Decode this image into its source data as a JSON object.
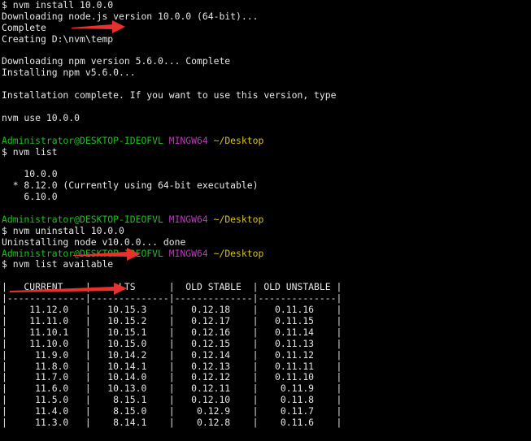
{
  "colors": {
    "background": "#000000",
    "text": "#e6e6e6",
    "prompt_user": "#1fc01f",
    "prompt_system": "#c037c0",
    "prompt_path": "#d8c31c",
    "annotation_arrow": "#e8302c"
  },
  "prompt": {
    "user_host": "Administrator@DESKTOP-IDEOFVL",
    "system": "MINGW64",
    "path": "~/Desktop"
  },
  "lines": [
    {
      "type": "text",
      "text": "$ nvm install 10.0.0"
    },
    {
      "type": "text",
      "text": "Downloading node.js version 10.0.0 (64-bit)..."
    },
    {
      "type": "text",
      "text": "Complete"
    },
    {
      "type": "text",
      "text": "Creating D:\\nvm\\temp"
    },
    {
      "type": "text",
      "text": ""
    },
    {
      "type": "text",
      "text": "Downloading npm version 5.6.0... Complete"
    },
    {
      "type": "text",
      "text": "Installing npm v5.6.0..."
    },
    {
      "type": "text",
      "text": ""
    },
    {
      "type": "text",
      "text": "Installation complete. If you want to use this version, type"
    },
    {
      "type": "text",
      "text": ""
    },
    {
      "type": "text",
      "text": "nvm use 10.0.0"
    },
    {
      "type": "text",
      "text": ""
    },
    {
      "type": "prompt"
    },
    {
      "type": "text",
      "text": "$ nvm list"
    },
    {
      "type": "text",
      "text": ""
    },
    {
      "type": "text",
      "text": "    10.0.0"
    },
    {
      "type": "text",
      "text": "  * 8.12.0 (Currently using 64-bit executable)"
    },
    {
      "type": "text",
      "text": "    6.10.0"
    },
    {
      "type": "text",
      "text": ""
    },
    {
      "type": "prompt"
    },
    {
      "type": "text",
      "text": "$ nvm uninstall 10.0.0"
    },
    {
      "type": "text",
      "text": "Uninstalling node v10.0.0... done"
    },
    {
      "type": "prompt"
    },
    {
      "type": "text",
      "text": "$ nvm list available"
    },
    {
      "type": "text",
      "text": ""
    },
    {
      "type": "text",
      "text": "|   CURRENT    |     LTS      |  OLD STABLE  | OLD UNSTABLE |"
    },
    {
      "type": "text",
      "text": "|--------------|--------------|--------------|--------------|"
    },
    {
      "type": "text",
      "text": "|    11.12.0   |   10.15.3    |   0.12.18    |   0.11.16    |"
    },
    {
      "type": "text",
      "text": "|    11.11.0   |   10.15.2    |   0.12.17    |   0.11.15    |"
    },
    {
      "type": "text",
      "text": "|    11.10.1   |   10.15.1    |   0.12.16    |   0.11.14    |"
    },
    {
      "type": "text",
      "text": "|    11.10.0   |   10.15.0    |   0.12.15    |   0.11.13    |"
    },
    {
      "type": "text",
      "text": "|     11.9.0   |   10.14.2    |   0.12.14    |   0.11.12    |"
    },
    {
      "type": "text",
      "text": "|     11.8.0   |   10.14.1    |   0.12.13    |   0.11.11    |"
    },
    {
      "type": "text",
      "text": "|     11.7.0   |   10.14.0    |   0.12.12    |   0.11.10    |"
    },
    {
      "type": "text",
      "text": "|     11.6.0   |   10.13.0    |   0.12.11    |    0.11.9    |"
    },
    {
      "type": "text",
      "text": "|     11.5.0   |    8.15.1    |   0.12.10    |    0.11.8    |"
    },
    {
      "type": "text",
      "text": "|     11.4.0   |    8.15.0    |    0.12.9    |    0.11.7    |"
    },
    {
      "type": "text",
      "text": "|     11.3.0   |    8.14.1    |    0.12.8    |    0.11.6    |"
    }
  ]
}
